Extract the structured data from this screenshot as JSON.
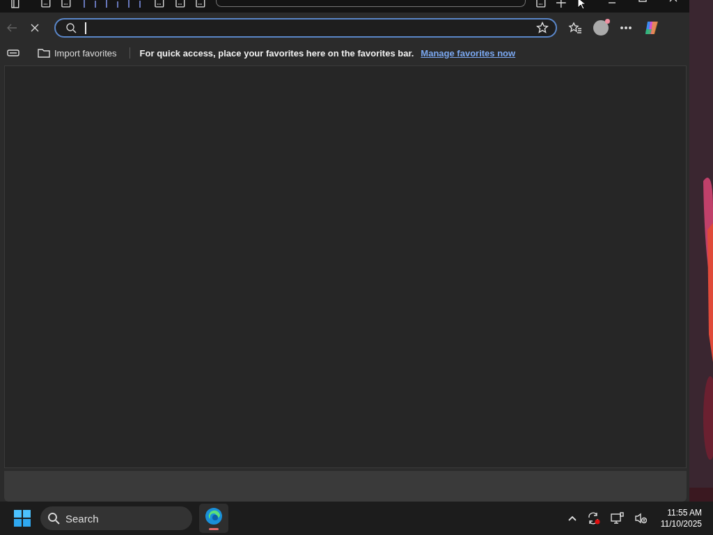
{
  "browser": {
    "address_bar": {
      "focused": true
    },
    "favorites_bar": {
      "import_label": "Import favorites",
      "message": "For quick access, place your favorites here on the favorites bar.",
      "link": "Manage favorites now"
    }
  },
  "taskbar": {
    "search": {
      "placeholder": "Search"
    },
    "apps": [
      {
        "selected": true
      }
    ],
    "clock": {
      "time": "11:55 AM",
      "date": "11/10/2025"
    }
  }
}
